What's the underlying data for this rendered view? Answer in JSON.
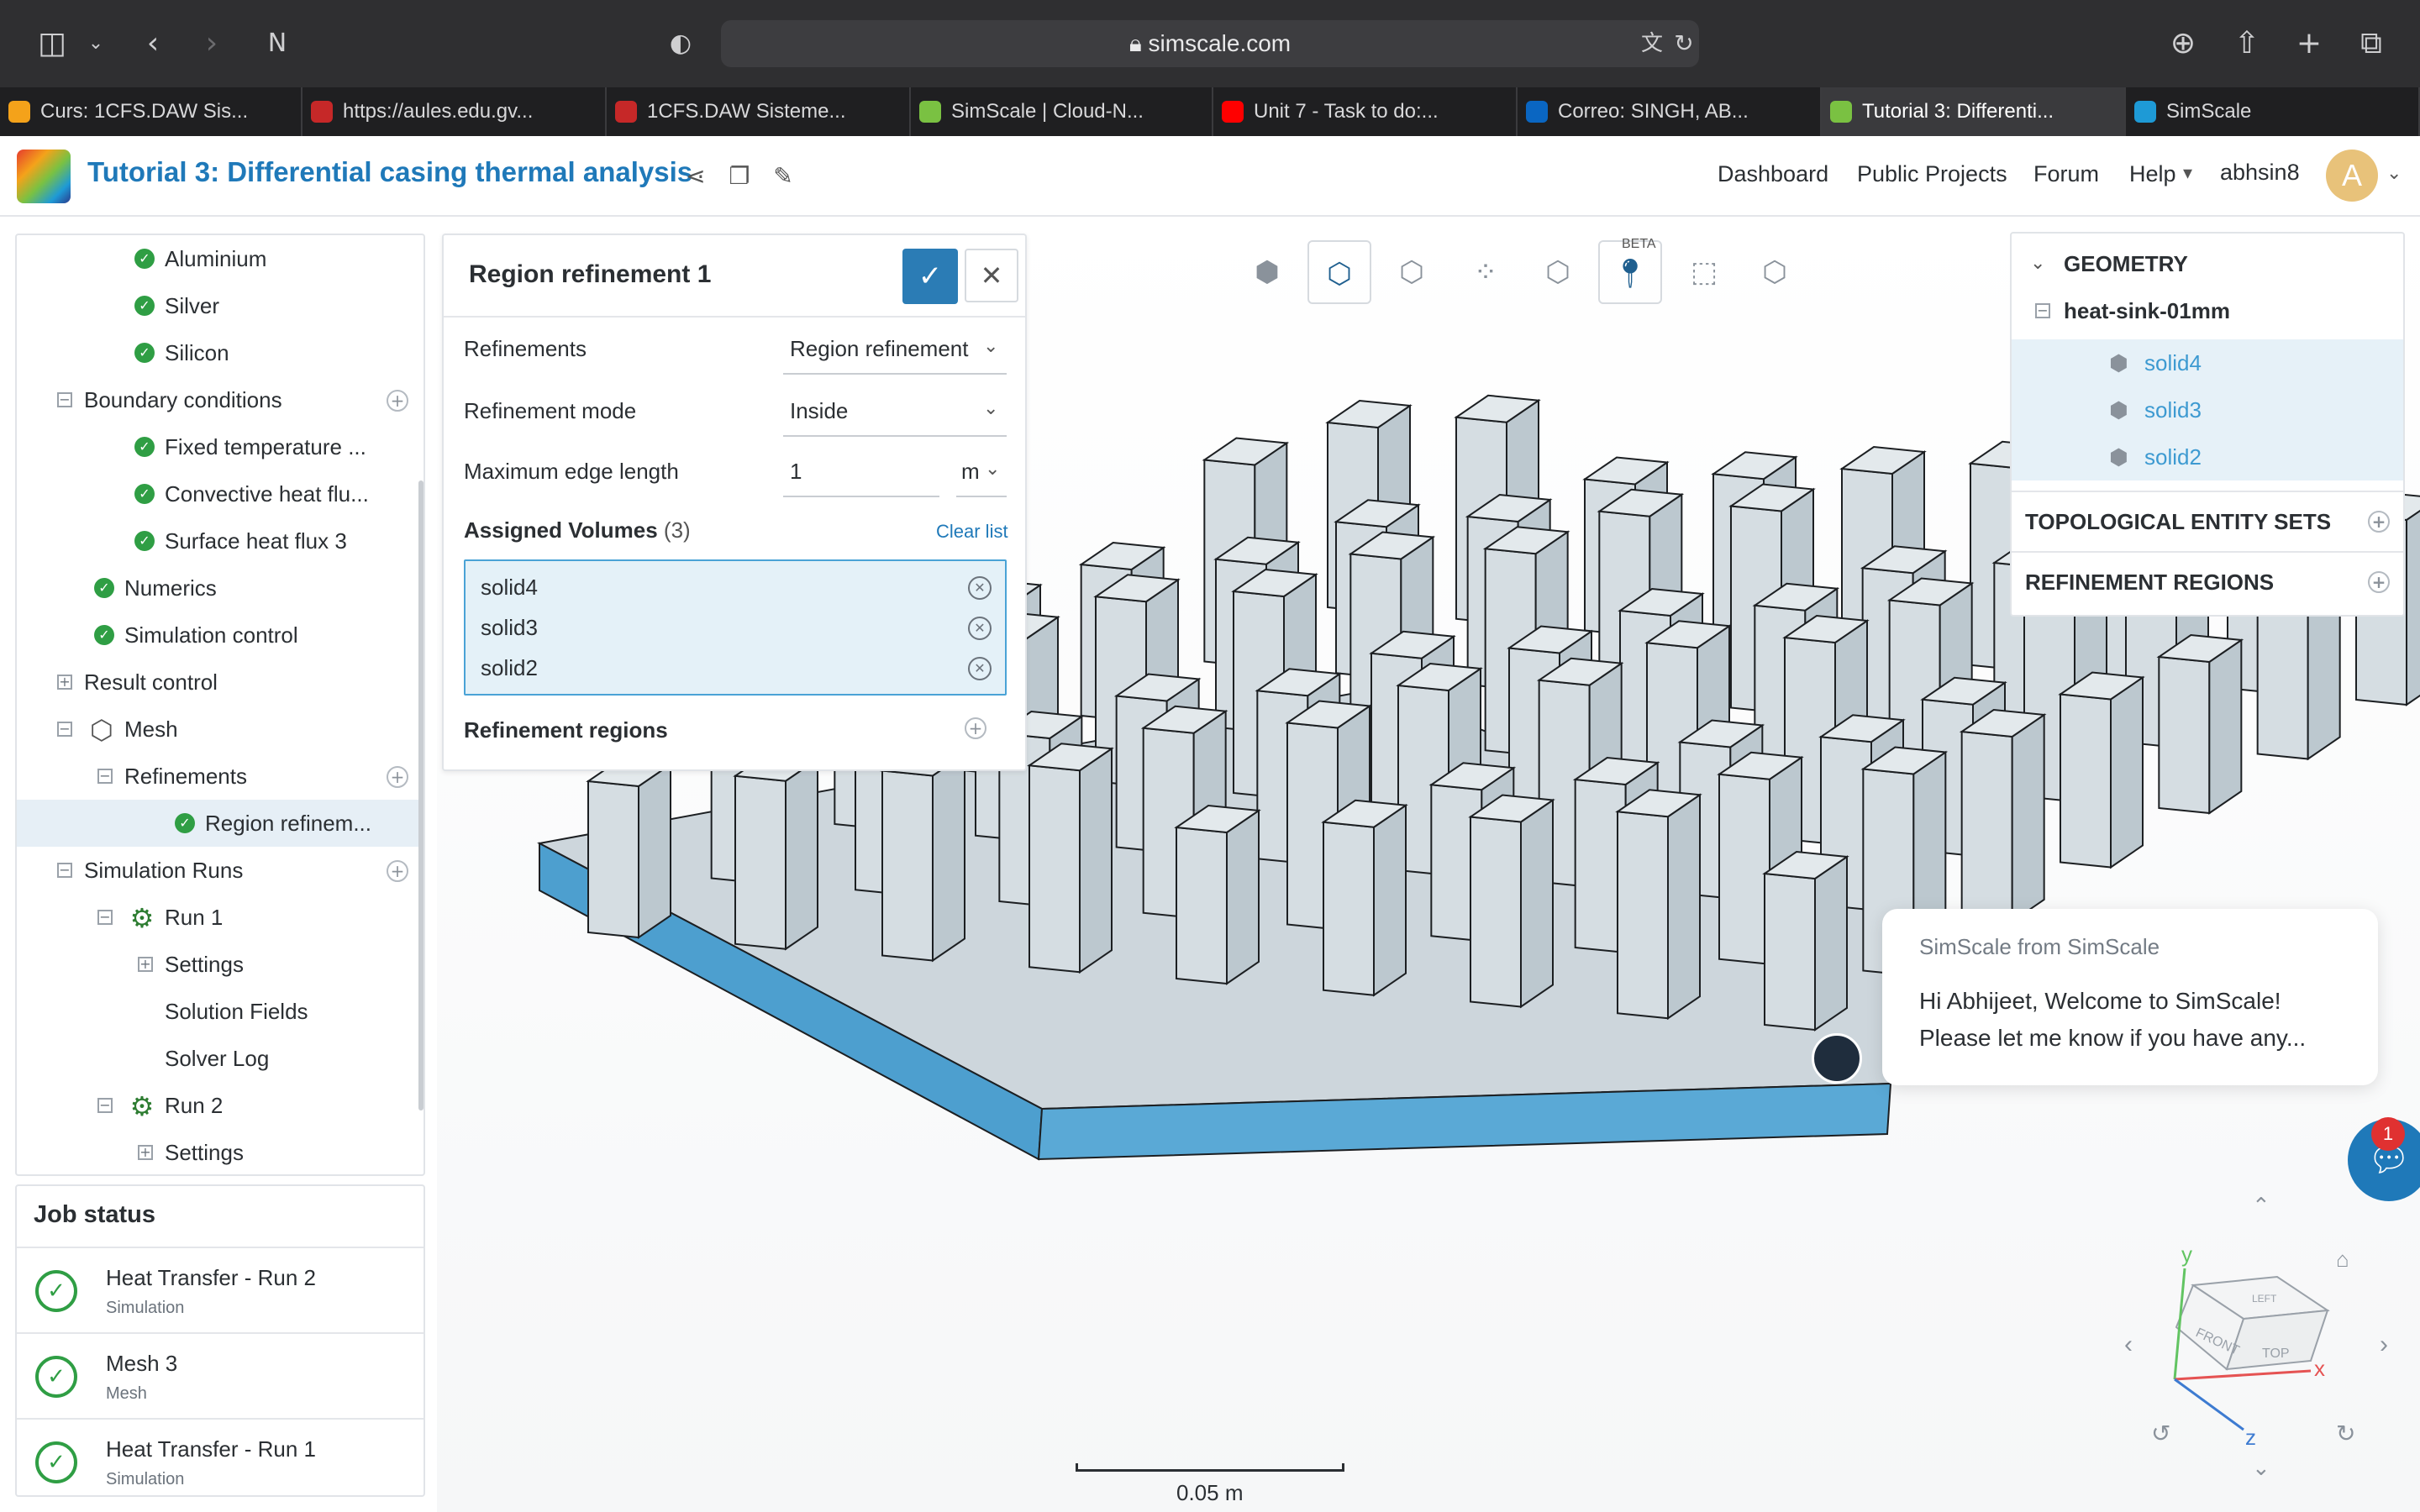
{
  "browser": {
    "url": "simscale.com",
    "tabs": [
      {
        "label": "Curs: 1CFS.DAW Sis...",
        "favicon_color": "#f4a21a",
        "active": false
      },
      {
        "label": "https://aules.edu.gv...",
        "favicon_color": "#c62828",
        "active": false
      },
      {
        "label": "1CFS.DAW Sisteme...",
        "favicon_color": "#c62828",
        "active": false
      },
      {
        "label": "SimScale | Cloud-N...",
        "favicon_color": "#7ac142",
        "active": false
      },
      {
        "label": "Unit 7 - Task to do:...",
        "favicon_color": "#ff0000",
        "active": false
      },
      {
        "label": "Correo: SINGH, AB...",
        "favicon_color": "#0a66c2",
        "active": false
      },
      {
        "label": "Tutorial 3: Differenti...",
        "favicon_color": "#7ac142",
        "active": true
      },
      {
        "label": "SimScale",
        "favicon_color": "#1e9ad6",
        "active": false
      }
    ]
  },
  "header": {
    "title": "Tutorial 3: Differential casing thermal analysis",
    "nav": [
      "Dashboard",
      "Public Projects",
      "Forum",
      "Help"
    ],
    "username": "abhsin8",
    "avatar_letter": "A"
  },
  "tree": {
    "rows": [
      {
        "label": "Aluminium",
        "type": "check",
        "level": 3
      },
      {
        "label": "Silver",
        "type": "check",
        "level": 3
      },
      {
        "label": "Silicon",
        "type": "check",
        "level": 3
      },
      {
        "label": "Boundary conditions",
        "type": "expander",
        "expander": "−",
        "level": 1,
        "plus": true
      },
      {
        "label": "Fixed temperature ...",
        "type": "check",
        "level": 3
      },
      {
        "label": "Convective heat flu...",
        "type": "check",
        "level": 3
      },
      {
        "label": "Surface heat flux 3",
        "type": "check",
        "level": 3
      },
      {
        "label": "Numerics",
        "type": "check",
        "level": 2
      },
      {
        "label": "Simulation control",
        "type": "check",
        "level": 2
      },
      {
        "label": "Result control",
        "type": "expander",
        "expander": "+",
        "level": 1
      },
      {
        "label": "Mesh",
        "type": "meshicon",
        "expander": "−",
        "level": 2
      },
      {
        "label": "Refinements",
        "type": "expander",
        "expander": "−",
        "level": 2,
        "plus": true
      },
      {
        "label": "Region refinem...",
        "type": "check",
        "level": 4,
        "selected": true
      },
      {
        "label": "Simulation Runs",
        "type": "expander",
        "expander": "−",
        "level": 1,
        "plus": true
      },
      {
        "label": "Run 1",
        "type": "gear",
        "expander": "−",
        "level": 3
      },
      {
        "label": "Settings",
        "type": "expander",
        "expander": "+",
        "level": 3
      },
      {
        "label": "Solution Fields",
        "type": "plain",
        "level": 3
      },
      {
        "label": "Solver Log",
        "type": "plain",
        "level": 3
      },
      {
        "label": "Run 2",
        "type": "gear",
        "expander": "−",
        "level": 3
      },
      {
        "label": "Settings",
        "type": "expander",
        "expander": "+",
        "level": 3
      }
    ]
  },
  "job_status": {
    "title": "Job status",
    "items": [
      {
        "name": "Heat Transfer - Run 2",
        "type": "Simulation"
      },
      {
        "name": "Mesh 3",
        "type": "Mesh"
      },
      {
        "name": "Heat Transfer - Run 1",
        "type": "Simulation"
      }
    ]
  },
  "refinement_panel": {
    "title": "Region refinement 1",
    "refinements_label": "Refinements",
    "refinements_value": "Region refinement",
    "mode_label": "Refinement mode",
    "mode_value": "Inside",
    "edge_label": "Maximum edge length",
    "edge_value": "1",
    "edge_unit": "m",
    "assigned_label": "Assigned Volumes",
    "assigned_count": "(3)",
    "clear_label": "Clear list",
    "volumes": [
      "solid4",
      "solid3",
      "solid2"
    ],
    "regions_label": "Refinement regions"
  },
  "viewport_tools": {
    "beta_label": "BETA"
  },
  "geometry_panel": {
    "title": "GEOMETRY",
    "root": "heat-sink-01mm",
    "solids": [
      "solid4",
      "solid3",
      "solid2"
    ],
    "sections": [
      "TOPOLOGICAL ENTITY SETS",
      "REFINEMENT REGIONS"
    ]
  },
  "chat": {
    "from": "SimScale from SimScale",
    "message": "Hi Abhijeet, Welcome to SimScale! Please let me know if you have any...",
    "badge": "1"
  },
  "orientation_cube": {
    "y": "y",
    "x": "x",
    "z": "z",
    "faces": [
      "FRONT",
      "TOP",
      "LEFT"
    ]
  },
  "scale_bar": "0.05 m",
  "colors": {
    "accent": "#1f79b9",
    "success": "#2f9e44",
    "selection": "#e4f1f8",
    "heatsink_base": "#4d9fcf",
    "heatsink_body": "#cdd6dc"
  }
}
